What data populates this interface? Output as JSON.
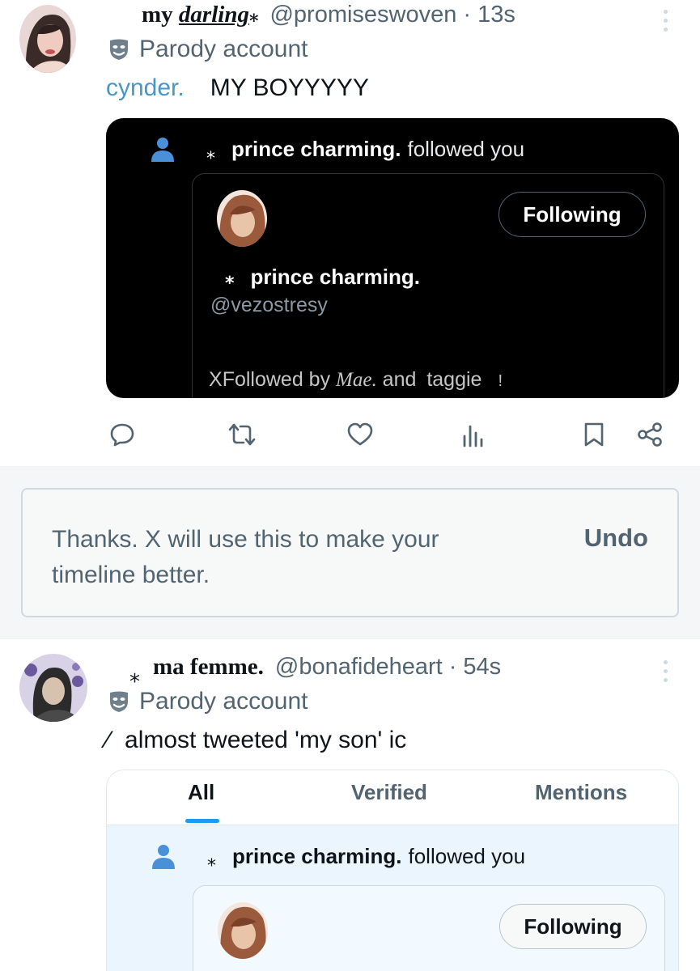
{
  "post1": {
    "display_name_prefix": "my ",
    "display_name_stylized": "darling",
    "display_name_star": "⁎",
    "handle": "@promiseswoven",
    "time": "· 13s",
    "parody_label": "Parody account",
    "mention": "cynder.",
    "text": "MY BOYYYYY",
    "embed": {
      "star": "⁎",
      "notif_name": "prince charming.",
      "notif_action": "followed you",
      "follow_button": "Following",
      "card_star": "⁎",
      "card_name": "prince charming.",
      "card_handle": "@vezostresy",
      "followed_by_x": "X",
      "followed_by_label": "Followed by ",
      "followed_by_name1": "Mae.",
      "followed_by_and": " and ",
      "followed_by_name2": "taggie",
      "followed_by_end": "!"
    }
  },
  "feedback": {
    "message": "Thanks. X will use this to make your timeline better.",
    "undo_label": "Undo"
  },
  "post2": {
    "star": "⁎",
    "display_name": "ma femme.",
    "handle": "@bonafideheart",
    "time": "· 54s",
    "parody_label": "Parody account",
    "text_prefix": "⁄",
    "text": "almost tweeted 'my son' ic",
    "embed": {
      "tabs": [
        "All",
        "Verified",
        "Mentions"
      ],
      "active_tab": "All",
      "star": "⁎",
      "notif_name": "prince charming.",
      "notif_action": "followed you",
      "follow_button": "Following"
    }
  },
  "icons": {
    "reply": "reply-icon",
    "repost": "repost-icon",
    "like": "like-icon",
    "views": "views-icon",
    "bookmark": "bookmark-icon",
    "share": "share-icon",
    "parody": "parody-mask-icon",
    "follow": "person-icon",
    "more": "more-vertical-icon"
  },
  "colors": {
    "accent": "#1d9bf0",
    "mention": "#4a95c8",
    "muted": "#536471",
    "person_icon": "#4a90d9"
  }
}
